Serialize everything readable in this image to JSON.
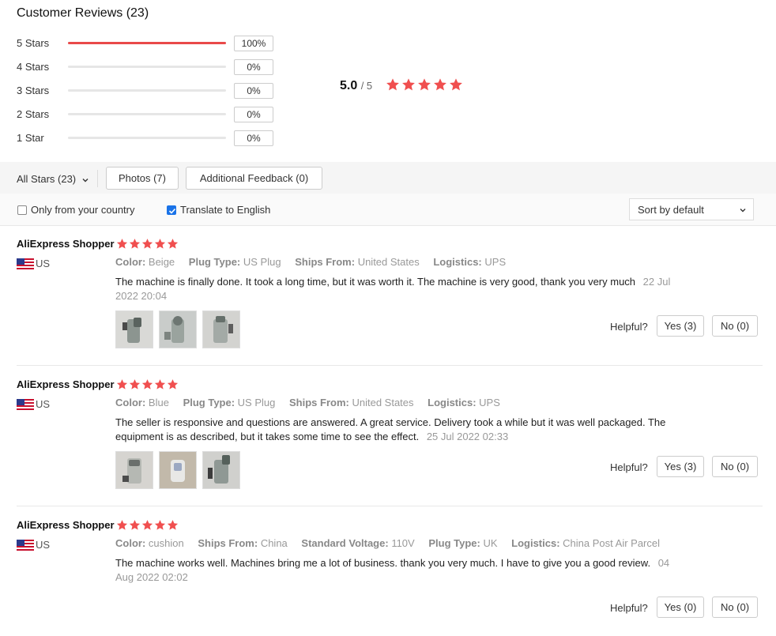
{
  "title": "Customer Reviews (23)",
  "breakdown": [
    {
      "label": "5 Stars",
      "pct": "100%",
      "fill": 1.0
    },
    {
      "label": "4 Stars",
      "pct": "0%",
      "fill": 0
    },
    {
      "label": "3 Stars",
      "pct": "0%",
      "fill": 0
    },
    {
      "label": "2 Stars",
      "pct": "0%",
      "fill": 0
    },
    {
      "label": "1 Star",
      "pct": "0%",
      "fill": 0
    }
  ],
  "average": {
    "score": "5.0",
    "outof": "/ 5",
    "stars": 5
  },
  "filters": {
    "all_stars": "All Stars (23)",
    "photos": "Photos (7)",
    "additional": "Additional Feedback (0)",
    "only_country": "Only from your country",
    "translate": "Translate to English",
    "translate_checked": true,
    "only_country_checked": false,
    "sort": "Sort by default"
  },
  "helpful_label": "Helpful?",
  "colors": {
    "star": "#f04f4f",
    "bar": "#e94a4a",
    "checkbox": "#1a73e8"
  },
  "reviews": [
    {
      "name": "AliExpress Shopper",
      "country": "US",
      "stars": 5,
      "attr_keys": [
        "Color:",
        "Plug Type:",
        "Ships From:",
        "Logistics:"
      ],
      "attr_vals": [
        "Beige",
        "US Plug",
        "United States",
        "UPS"
      ],
      "text": "The machine is finally done. It took a long time, but it was worth it. The machine is very good, thank you very much",
      "date": "22 Jul 2022 20:04",
      "yes": "Yes (3)",
      "no": "No (0)",
      "photos": 3
    },
    {
      "name": "AliExpress Shopper",
      "country": "US",
      "stars": 5,
      "attr_keys": [
        "Color:",
        "Plug Type:",
        "Ships From:",
        "Logistics:"
      ],
      "attr_vals": [
        "Blue",
        "US Plug",
        "United States",
        "UPS"
      ],
      "text": "The seller is responsive and questions are answered. A great service. Delivery took a while but it was well packaged. The equipment is as described, but it takes some time to see the effect.",
      "date": "25 Jul 2022 02:33",
      "yes": "Yes (3)",
      "no": "No (0)",
      "photos": 3
    },
    {
      "name": "AliExpress Shopper",
      "country": "US",
      "stars": 5,
      "attr_keys": [
        "Color:",
        "Ships From:",
        "Standard Voltage:",
        "Plug Type:",
        "Logistics:"
      ],
      "attr_vals": [
        "cushion",
        "China",
        "110V",
        "UK",
        "China Post Air Parcel"
      ],
      "text": "The machine works well. Machines bring me a lot of business. thank you very much. I have to give you a good review.",
      "date": "04 Aug 2022 02:02",
      "yes": "Yes (0)",
      "no": "No (0)",
      "photos": 0
    }
  ]
}
